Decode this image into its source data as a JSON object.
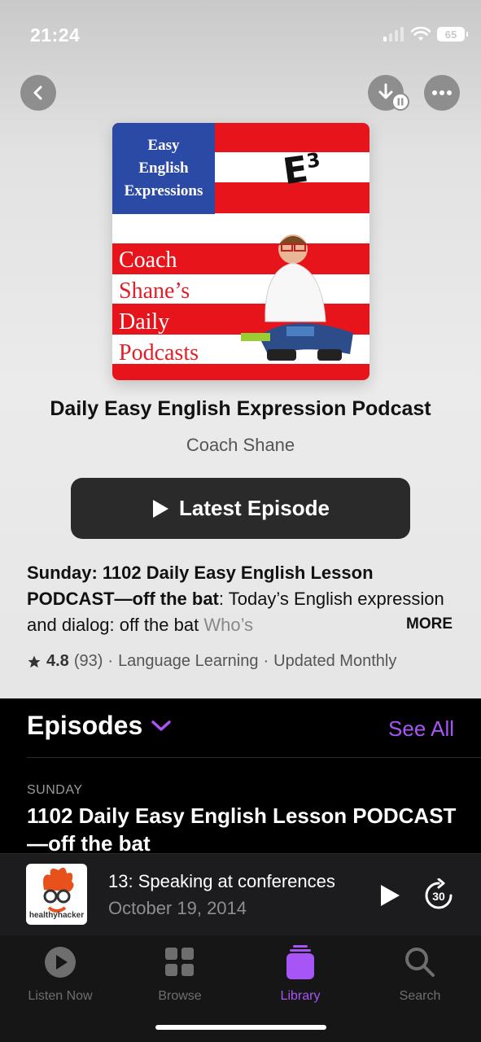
{
  "status_bar": {
    "time": "21:24",
    "battery": "65"
  },
  "artwork": {
    "title_lines": [
      "Easy",
      "English",
      "Expressions"
    ],
    "badge": "E",
    "badge_sup": "3",
    "lines": [
      "Coach",
      "Shane’s",
      "Daily",
      "Podcasts"
    ]
  },
  "podcast": {
    "title": "Daily Easy English Expression Podcast",
    "author": "Coach Shane",
    "latest_button": "Latest Episode",
    "description_bold": "Sunday: 1102 Daily Easy English Lesson PODCAST—off the bat",
    "description_rest": ": Today’s English expression and dialog:   off the bat   ",
    "description_fade": "Who’s",
    "more_label": "MORE",
    "rating": "4.8",
    "rating_count": "(93)",
    "category": "Language Learning",
    "update_freq": "Updated Monthly"
  },
  "episodes": {
    "heading": "Episodes",
    "see_all": "See All",
    "first": {
      "day": "SUNDAY",
      "title": "1102 Daily Easy English Lesson PODCAST—off the bat"
    }
  },
  "mini_player": {
    "title": "13: Speaking at conferences",
    "date": "October 19, 2014",
    "art_label": "healthyhacker",
    "skip_label": "30"
  },
  "tabs": [
    {
      "label": "Listen Now",
      "icon": "play-circle-icon"
    },
    {
      "label": "Browse",
      "icon": "grid-icon"
    },
    {
      "label": "Library",
      "icon": "library-stack-icon"
    },
    {
      "label": "Search",
      "icon": "search-icon"
    }
  ],
  "colors": {
    "accent": "#a855f7",
    "background_dark": "#000000",
    "button_dark": "#2a2a2a"
  }
}
